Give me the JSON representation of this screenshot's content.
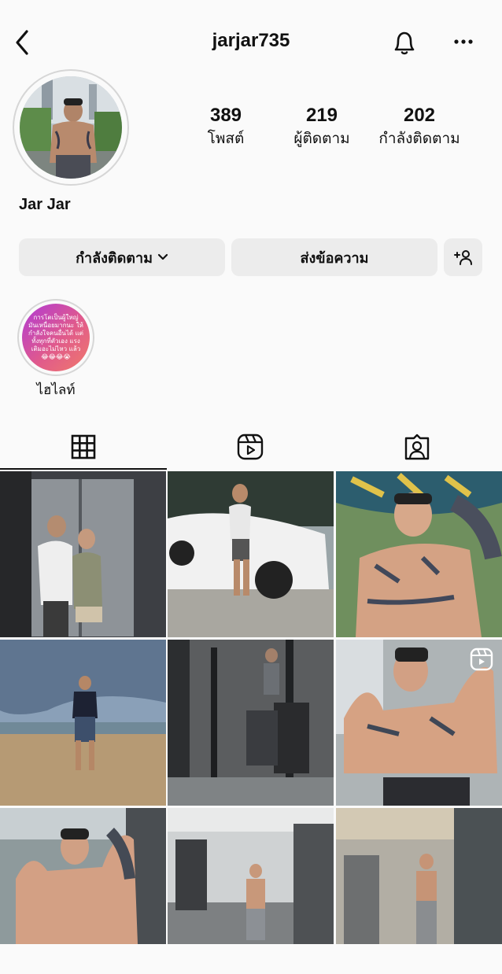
{
  "header": {
    "username": "jarjar735",
    "back_icon": "chevron-left-icon",
    "bell_icon": "bell-icon",
    "more_icon": "more-horizontal-icon"
  },
  "profile": {
    "display_name": "Jar Jar",
    "stats": [
      {
        "value": "389",
        "label": "โพสต์"
      },
      {
        "value": "219",
        "label": "ผู้ติดตาม"
      },
      {
        "value": "202",
        "label": "กำลังติดตาม"
      }
    ]
  },
  "actions": {
    "following_label": "กำลังติดตาม",
    "message_label": "ส่งข้อความ",
    "add_user_icon": "add-user-icon"
  },
  "highlights": [
    {
      "label": "ไฮไลท์",
      "cover_text": "การโตเป็นผู้ใหญ่ มันเหนื่อยมากนะ ให้กำลังใจคนอื่นได้ แต่ทั้งทุกที่ตัวเอง แรงเติมอะไม่ไหว แล้ว 😂😂😂😭"
    }
  ],
  "tabs": [
    {
      "name": "grid",
      "icon": "grid-icon",
      "active": true
    },
    {
      "name": "reels",
      "icon": "reels-icon",
      "active": false
    },
    {
      "name": "tagged",
      "icon": "tagged-icon",
      "active": false
    }
  ],
  "posts": [
    {
      "scene": "elevator-couple-selfie"
    },
    {
      "scene": "man-with-white-suv"
    },
    {
      "scene": "tattooed-torso-under-umbrella"
    },
    {
      "scene": "beach-standing"
    },
    {
      "scene": "gym-equipment-mirror"
    },
    {
      "scene": "flexing-shirtless-reel",
      "badge_icon": "reel-badge-icon"
    },
    {
      "scene": "flexing-shirtless-gym"
    },
    {
      "scene": "gym-mirror-selfie"
    },
    {
      "scene": "gym-treadmill-selfie"
    }
  ],
  "colors": {
    "background": "#fafafa",
    "button_bg": "#ececec",
    "text": "#111111",
    "highlight_gradient_start": "#b03ad6",
    "highlight_gradient_end": "#f07a6a"
  }
}
